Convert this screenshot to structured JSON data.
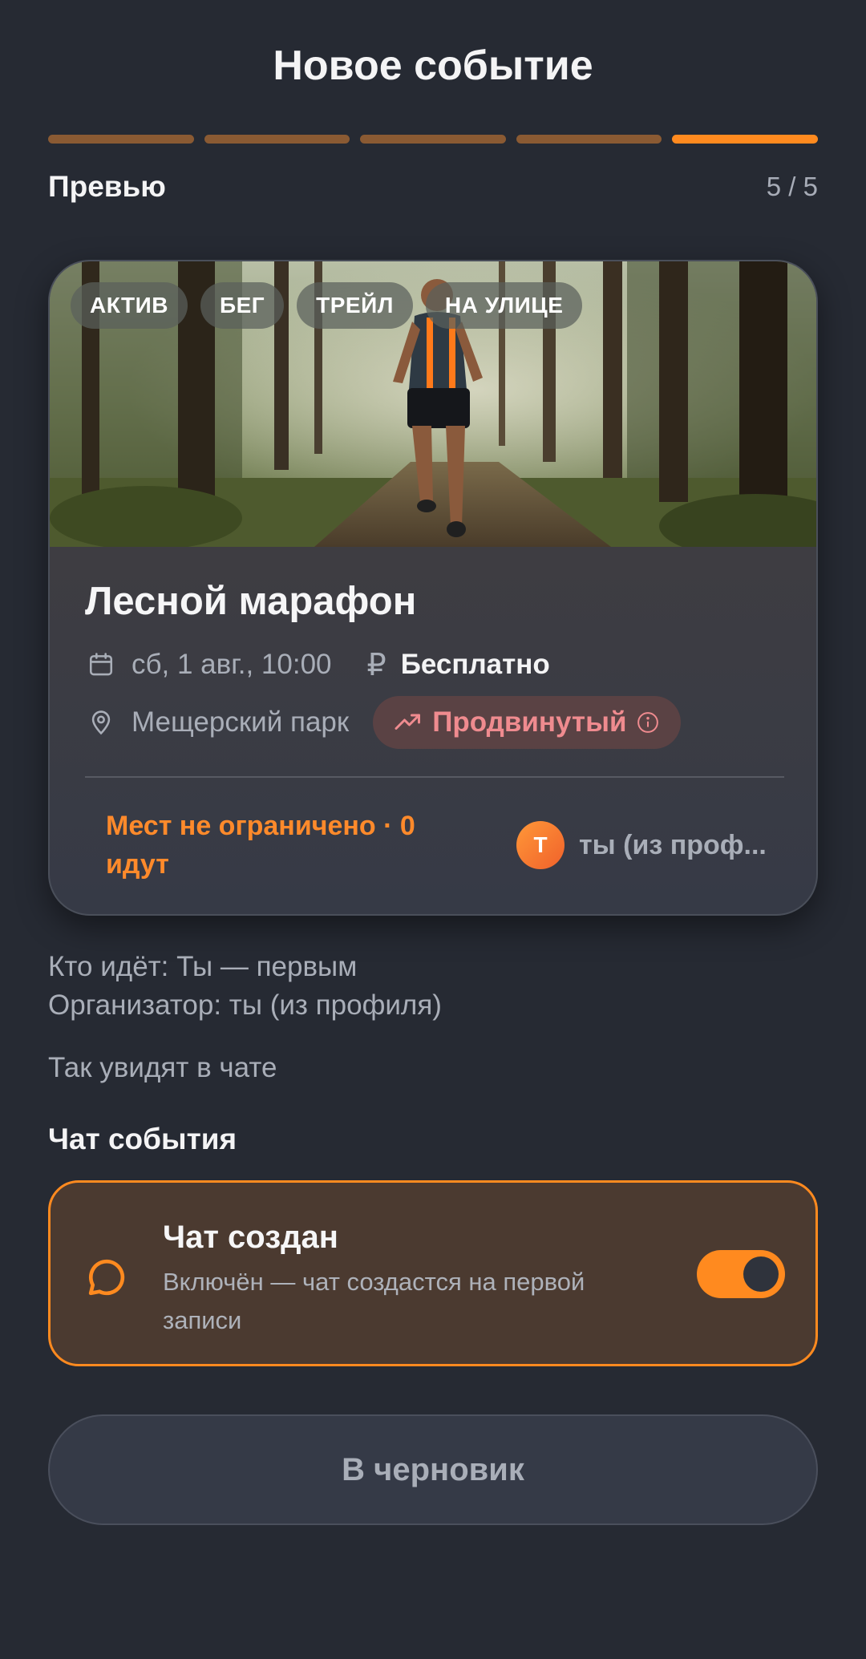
{
  "header": {
    "title": "Новое событие"
  },
  "progress": {
    "total_steps": 5,
    "current_step": 5
  },
  "step": {
    "label": "Превью",
    "counter": "5 / 5"
  },
  "event_card": {
    "tags": [
      "АКТИВ",
      "БЕГ",
      "ТРЕЙЛ",
      "НА УЛИЦЕ"
    ],
    "title": "Лесной марафон",
    "datetime": "сб, 1 авг., 10:00",
    "currency_symbol": "₽",
    "price": "Бесплатно",
    "location": "Мещерский парк",
    "level": "Продвинутый",
    "spots": "Мест не ограничено · 0 идут",
    "organizer_initial": "Т",
    "organizer_name": "ты (из проф..."
  },
  "info": {
    "who_going": "Кто идёт: Ты — первым",
    "organizer": "Организатор: ты (из профиля)"
  },
  "chat_hint": "Так увидят в чате",
  "chat_section": {
    "title": "Чат события",
    "card_title": "Чат создан",
    "card_desc": "Включён — чат создастся на первой записи",
    "enabled": true
  },
  "draft_button": {
    "label": "В черновик"
  },
  "colors": {
    "accent": "#ff8a1f",
    "background": "#262a33",
    "level": "#ef8b8f"
  }
}
